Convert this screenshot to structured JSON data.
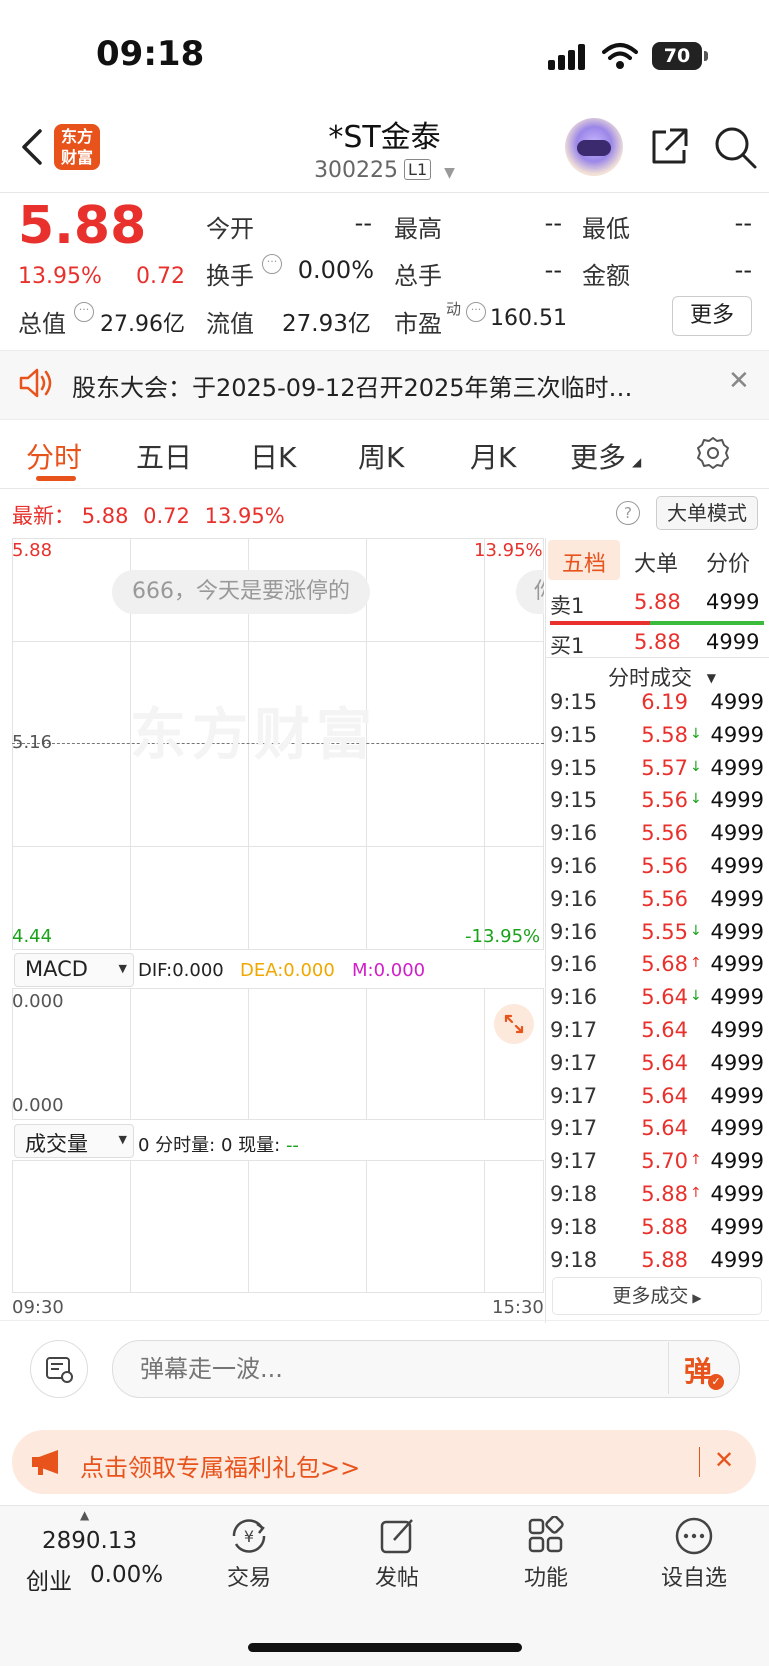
{
  "status_bar": {
    "time": "09:18",
    "battery": "70"
  },
  "header": {
    "logo_text": "东方\n财富",
    "title": "*ST金泰",
    "code": "300225",
    "level": "L1"
  },
  "quote": {
    "price": "5.88",
    "change_pct": "13.95%",
    "change": "0.72",
    "items": {
      "open_label": "今开",
      "open_value": "--",
      "high_label": "最高",
      "high_value": "--",
      "low_label": "最低",
      "low_value": "--",
      "turnover_label": "换手",
      "turnover_value": "0.00%",
      "volume_label": "总手",
      "volume_value": "--",
      "amount_label": "金额",
      "amount_value": "--",
      "mcap_label": "总值",
      "mcap_value": "27.96亿",
      "float_label": "流值",
      "float_value": "27.93亿",
      "pe_label": "市盈",
      "pe_sup": "动",
      "pe_value": "160.51"
    },
    "more_label": "更多"
  },
  "notice": {
    "text": "股东大会：于2025-09-12召开2025年第三次临时…"
  },
  "tabs": [
    "分时",
    "五日",
    "日K",
    "周K",
    "月K",
    "更多"
  ],
  "latest": {
    "label": "最新：",
    "price": "5.88",
    "change": "0.72",
    "pct": "13.95%"
  },
  "big_order_mode": "大单模式",
  "chart": {
    "price_max": "5.88",
    "pct_max": "13.95%",
    "mid": "5.16",
    "price_min": "4.44",
    "pct_min": "-13.95%",
    "danmaku": "666，今天是要涨停的",
    "danmaku_partial": "你",
    "watermark": "东方财富",
    "macd_selector": "MACD",
    "dif": "DIF:0.000",
    "dea": "DEA:0.000",
    "m": "M:0.000",
    "macd_top": "0.000",
    "macd_bottom": "0.000",
    "vol_selector": "成交量",
    "vol_info_prefix": "0 分时量: 0 现量:",
    "vol_info_suffix": "--",
    "time_start": "09:30",
    "time_end": "15:30"
  },
  "side": {
    "tabs": [
      "五档",
      "大单",
      "分价"
    ],
    "sell1_label": "卖1",
    "sell1_price": "5.88",
    "sell1_vol": "4999",
    "buy1_label": "买1",
    "buy1_price": "5.88",
    "buy1_vol": "4999",
    "trades_header": "分时成交",
    "trades": [
      {
        "time": "9:15",
        "price": "6.19",
        "dir": "",
        "vol": "4999"
      },
      {
        "time": "9:15",
        "price": "5.58",
        "dir": "down",
        "vol": "4999"
      },
      {
        "time": "9:15",
        "price": "5.57",
        "dir": "down",
        "vol": "4999"
      },
      {
        "time": "9:15",
        "price": "5.56",
        "dir": "down",
        "vol": "4999"
      },
      {
        "time": "9:16",
        "price": "5.56",
        "dir": "",
        "vol": "4999"
      },
      {
        "time": "9:16",
        "price": "5.56",
        "dir": "",
        "vol": "4999"
      },
      {
        "time": "9:16",
        "price": "5.56",
        "dir": "",
        "vol": "4999"
      },
      {
        "time": "9:16",
        "price": "5.55",
        "dir": "down",
        "vol": "4999"
      },
      {
        "time": "9:16",
        "price": "5.68",
        "dir": "up",
        "vol": "4999"
      },
      {
        "time": "9:16",
        "price": "5.64",
        "dir": "down",
        "vol": "4999"
      },
      {
        "time": "9:17",
        "price": "5.64",
        "dir": "",
        "vol": "4999"
      },
      {
        "time": "9:17",
        "price": "5.64",
        "dir": "",
        "vol": "4999"
      },
      {
        "time": "9:17",
        "price": "5.64",
        "dir": "",
        "vol": "4999"
      },
      {
        "time": "9:17",
        "price": "5.64",
        "dir": "",
        "vol": "4999"
      },
      {
        "time": "9:17",
        "price": "5.70",
        "dir": "up",
        "vol": "4999"
      },
      {
        "time": "9:18",
        "price": "5.88",
        "dir": "up",
        "vol": "4999"
      },
      {
        "time": "9:18",
        "price": "5.88",
        "dir": "",
        "vol": "4999"
      },
      {
        "time": "9:18",
        "price": "5.88",
        "dir": "",
        "vol": "4999"
      }
    ],
    "more_trades": "更多成交"
  },
  "comment": {
    "placeholder": "弹幕走一波...",
    "send_label": "弹"
  },
  "promo": {
    "text": "点击领取专属福利礼包>>"
  },
  "tabbar": {
    "index_value": "2890.13",
    "index_name": "创业",
    "index_pct": "0.00%",
    "items": [
      "交易",
      "发帖",
      "功能",
      "设自选"
    ]
  },
  "colors": {
    "up": "#e8312c",
    "down": "#1aa31a",
    "accent": "#e8531c"
  }
}
